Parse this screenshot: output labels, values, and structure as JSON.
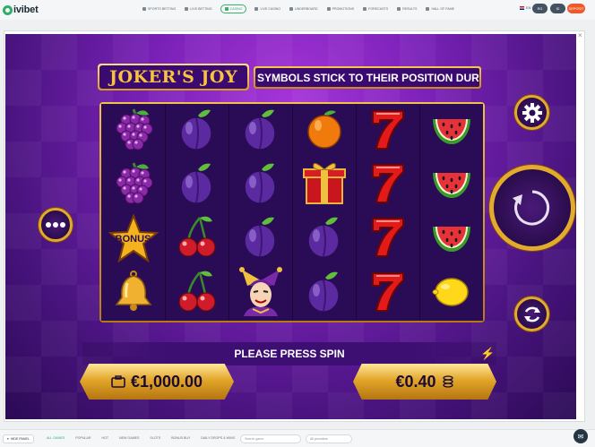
{
  "brand": {
    "name": "ivibet"
  },
  "nav": {
    "items": [
      {
        "label": "Sports betting"
      },
      {
        "label": "Live betting"
      },
      {
        "label": "Casino"
      },
      {
        "label": "Live casino"
      },
      {
        "label": "Underboard"
      },
      {
        "label": "Promotions"
      },
      {
        "label": "Forecasts"
      },
      {
        "label": "Results"
      },
      {
        "label": "Hall of fame"
      }
    ],
    "active_index": 2
  },
  "header_right": {
    "lang": "EN",
    "rg": "RG",
    "user": "ID",
    "deposit": "DEPOSIT"
  },
  "game": {
    "title": "JOKER'S JOY",
    "marquee": "SYMBOLS STICK TO THEIR POSITION DURING FREE G",
    "status": "PLEASE PRESS SPIN",
    "balance": "€1,000.00",
    "bet": "€0.40",
    "bonus_label": "BONUS",
    "reels": [
      [
        "grapes",
        "grapes",
        "bonus-star",
        "bell"
      ],
      [
        "plum",
        "plum",
        "cherries",
        "cherries"
      ],
      [
        "plum",
        "plum",
        "plum",
        "joker"
      ],
      [
        "orange",
        "gift",
        "plum",
        "plum"
      ],
      [
        "seven",
        "seven",
        "seven",
        "seven"
      ],
      [
        "watermelon",
        "watermelon",
        "watermelon",
        "lemon"
      ]
    ]
  },
  "bottom": {
    "hide_panel": "HIDE PANEL",
    "categories": [
      "All games",
      "Popular",
      "Hot",
      "New games",
      "Slots",
      "Bonus buy",
      "Daily drops & wins"
    ],
    "search_placeholder": "Search game",
    "provider_placeholder": "All providers"
  },
  "colors": {
    "accent": "#2eae6b",
    "deposit": "#f05a28",
    "gold": "#e3aa2e",
    "purple": "#7a21b8"
  }
}
